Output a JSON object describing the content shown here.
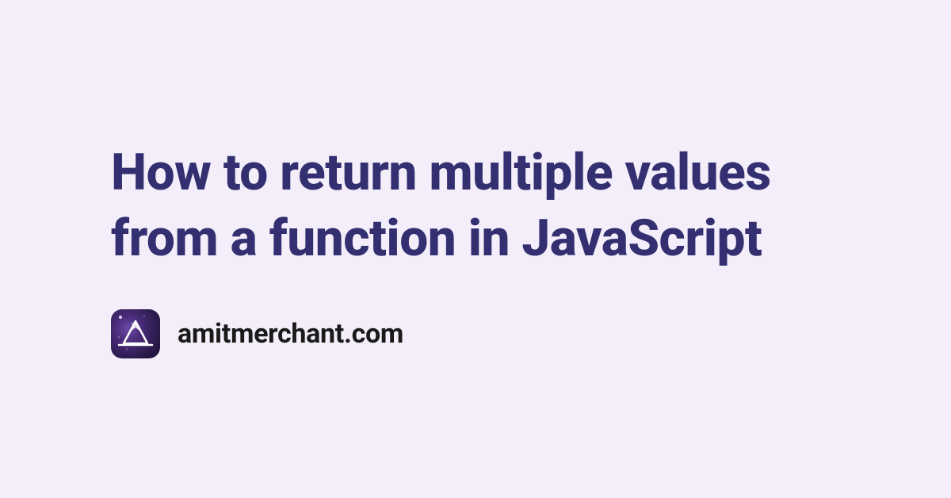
{
  "title": "How to return multiple values from a function in JavaScript",
  "site_name": "amitmerchant.com",
  "logo_alt": "mountain-logo",
  "colors": {
    "background": "#f3eefa",
    "title": "#332f70",
    "text": "#1a1a1a"
  }
}
